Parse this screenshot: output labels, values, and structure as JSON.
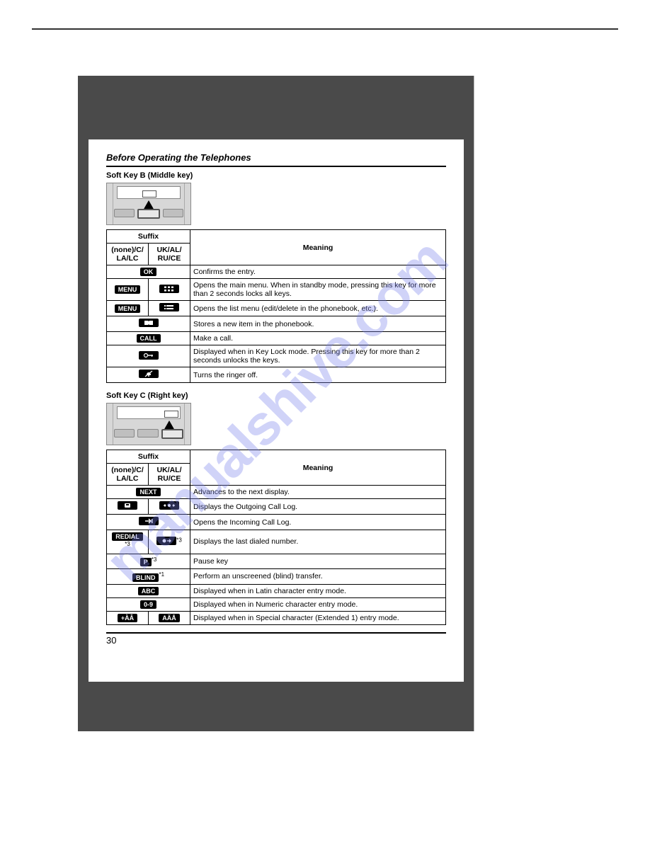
{
  "section_title": "Before Operating the Telephones",
  "soft_key_b": {
    "heading": "Soft Key B (Middle key)",
    "table": {
      "suffix_header": "Suffix",
      "col1": "(none)/C/\nLA/LC",
      "col2": "UK/AL/\nRU/CE",
      "meaning_header": "Meaning",
      "rows": [
        {
          "icon1": "OK",
          "icon2": "",
          "span": true,
          "meaning": "Confirms the entry."
        },
        {
          "icon1": "MENU",
          "icon2": "grid",
          "meaning": "Opens the main menu. When in standby mode, pressing this key for more than 2 seconds locks all keys."
        },
        {
          "icon1": "MENU",
          "icon2": "list",
          "meaning": "Opens the list menu (edit/delete in the phonebook, etc.)."
        },
        {
          "icon1": "book",
          "icon2": "",
          "span": true,
          "meaning": "Stores a new item in the phonebook."
        },
        {
          "icon1": "CALL",
          "icon2": "",
          "span": true,
          "meaning": "Make a call."
        },
        {
          "icon1": "key",
          "icon2": "",
          "span": true,
          "meaning": "Displayed when in Key Lock mode. Pressing this key for more than 2 seconds unlocks the keys."
        },
        {
          "icon1": "bell-off",
          "icon2": "",
          "span": true,
          "meaning": "Turns the ringer off."
        }
      ]
    }
  },
  "soft_key_c": {
    "heading": "Soft Key C (Right key)",
    "table": {
      "suffix_header": "Suffix",
      "col1": "(none)/C/\nLA/LC",
      "col2": "UK/AL/\nRU/CE",
      "meaning_header": "Meaning",
      "rows": [
        {
          "icon1": "NEXT",
          "icon2": "",
          "span": true,
          "meaning": "Advances to the next display."
        },
        {
          "icon1": "phone-out",
          "icon2": "arrows-out",
          "meaning": "Displays the Outgoing Call Log."
        },
        {
          "icon1": "arrow-in",
          "icon2": "",
          "span": true,
          "meaning": "Opens the Incoming Call Log."
        },
        {
          "icon1": "REDIAL",
          "icon1_note": "*3",
          "icon2": "redial-sym",
          "icon2_note": "*3",
          "meaning": "Displays the last dialed number."
        },
        {
          "icon1": "P",
          "icon1_note": "*3",
          "icon2": "",
          "span": true,
          "meaning": "Pause key"
        },
        {
          "icon1": "BLIND",
          "icon1_note": "*1",
          "icon2": "",
          "span": true,
          "meaning": "Perform an unscreened (blind) transfer."
        },
        {
          "icon1": "ABC",
          "icon2": "",
          "span": true,
          "meaning": "Displayed when in Latin character entry mode."
        },
        {
          "icon1": "0-9",
          "icon2": "",
          "span": true,
          "meaning": "Displayed when in Numeric character entry mode."
        },
        {
          "icon1": "+ÀÂ",
          "icon2": "AÄÅ",
          "meaning": "Displayed when in Special character (Extended 1) entry mode."
        }
      ]
    }
  },
  "page_number": "30",
  "watermark": "manualshive.com"
}
